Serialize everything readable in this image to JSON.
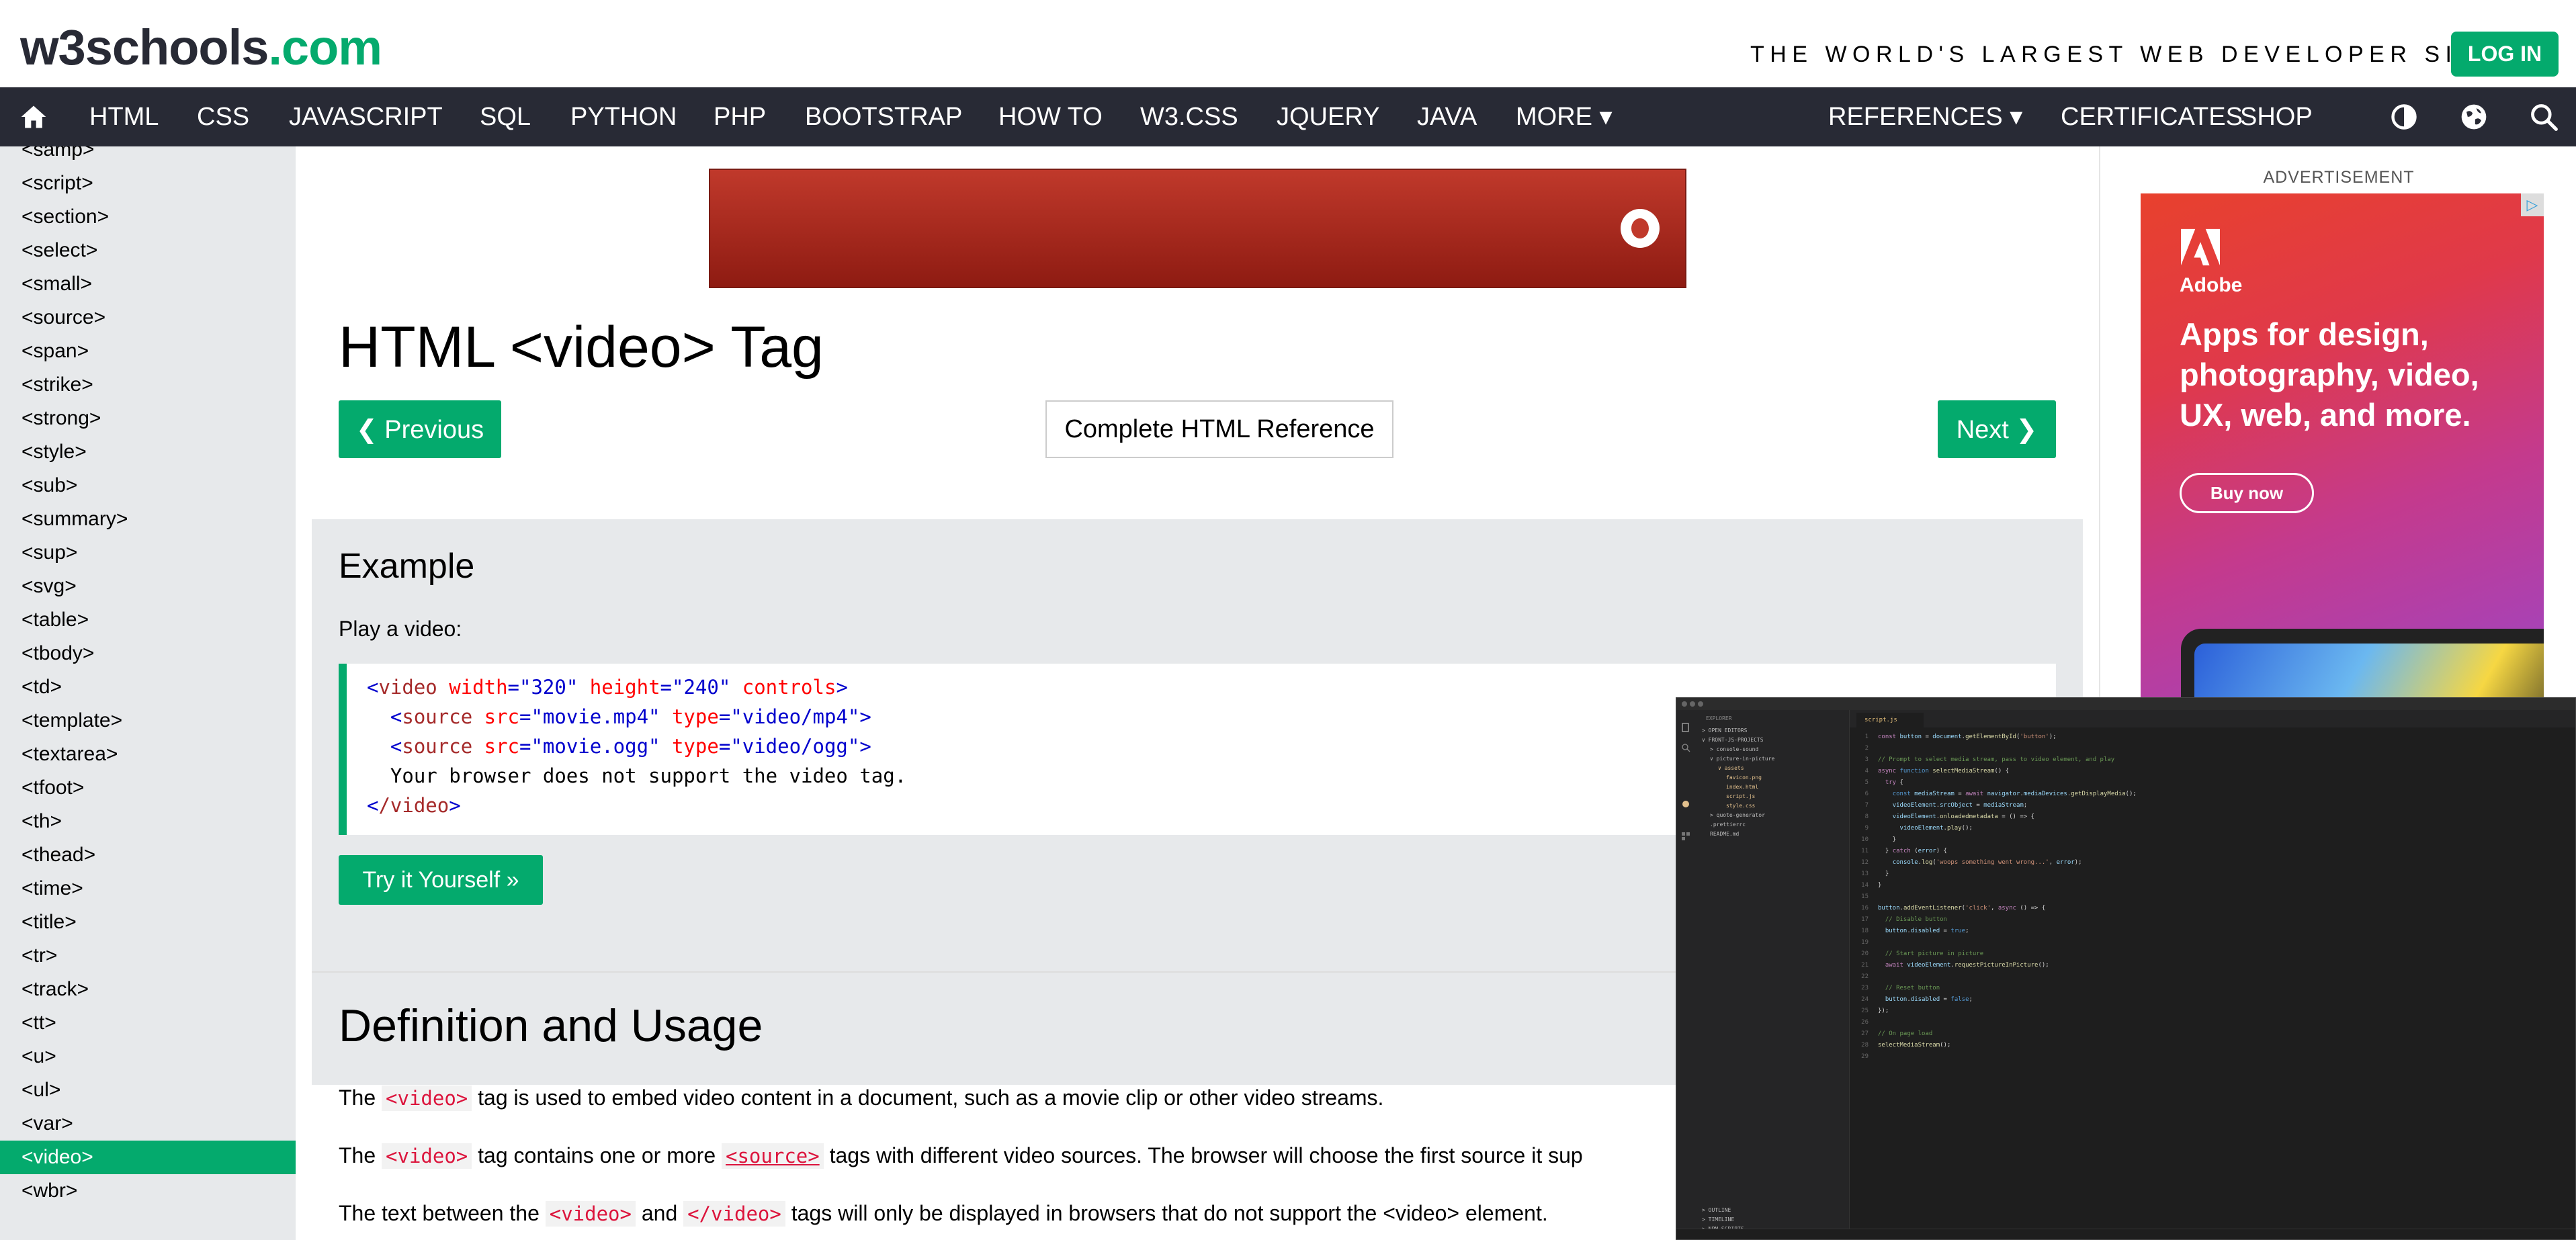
{
  "header": {
    "logo_main": "w3schools",
    "logo_suffix": ".com",
    "tagline": "THE WORLD'S LARGEST WEB DEVELOPER SITE",
    "login_label": "LOG IN"
  },
  "nav": {
    "items": [
      "HTML",
      "CSS",
      "JAVASCRIPT",
      "SQL",
      "PYTHON",
      "PHP",
      "BOOTSTRAP",
      "HOW TO",
      "W3.CSS",
      "JQUERY",
      "JAVA",
      "MORE ▾"
    ],
    "right_items": [
      "REFERENCES ▾",
      "CERTIFICATES",
      "SHOP"
    ],
    "icons": [
      "home-icon",
      "contrast-icon",
      "globe-icon",
      "search-icon"
    ]
  },
  "sidebar": {
    "items": [
      "<samp>",
      "<script>",
      "<section>",
      "<select>",
      "<small>",
      "<source>",
      "<span>",
      "<strike>",
      "<strong>",
      "<style>",
      "<sub>",
      "<summary>",
      "<sup>",
      "<svg>",
      "<table>",
      "<tbody>",
      "<td>",
      "<template>",
      "<textarea>",
      "<tfoot>",
      "<th>",
      "<thead>",
      "<time>",
      "<title>",
      "<tr>",
      "<track>",
      "<tt>",
      "<u>",
      "<ul>",
      "<var>",
      "<video>",
      "<wbr>"
    ],
    "active": "<video>"
  },
  "main": {
    "title": "HTML <video> Tag",
    "prev_label": "❮ Previous",
    "ref_label": "Complete HTML Reference",
    "next_label": "Next ❯",
    "example": {
      "heading": "Example",
      "desc": "Play a video:",
      "try_label": "Try it Yourself »"
    },
    "definition": {
      "heading": "Definition and Usage",
      "p1_before": "The ",
      "p1_code": "<video>",
      "p1_after": " tag is used to embed video content in a document, such as a movie clip or other video streams.",
      "p2_before": "The ",
      "p2_code": "<video>",
      "p2_mid": " tag contains one or more ",
      "p2_link": "<source>",
      "p2_after": " tags with different video sources. The browser will choose the first source it sup",
      "p3_before": "The text between the ",
      "p3_code1": "<video>",
      "p3_and": " and ",
      "p3_code2": "</video>",
      "p3_after": " tags will only be displayed in browsers that do not support the <video> element."
    }
  },
  "right": {
    "ad_label": "ADVERTISEMENT",
    "adobe_name": "Adobe",
    "adobe_headline": "Apps for design, photography, video, UX, web, and more.",
    "adobe_button": "Buy now",
    "colors": {
      "brand_green": "#04AA6D",
      "nav_dark": "#282A35"
    }
  },
  "editor": {
    "tab": "script.js",
    "explorer": [
      "EXPLORER",
      "> OPEN EDITORS",
      "∨ FRONT-JS-PROJECTS",
      "> console-sound",
      "∨ picture-in-picture",
      "∨ assets",
      "favicon.png",
      "index.html",
      "script.js",
      "style.css",
      "> quote-generator",
      ".prettierrc",
      "README.md",
      "> OUTLINE",
      "> TIMELINE",
      "> NPM SCRIPTS"
    ]
  }
}
